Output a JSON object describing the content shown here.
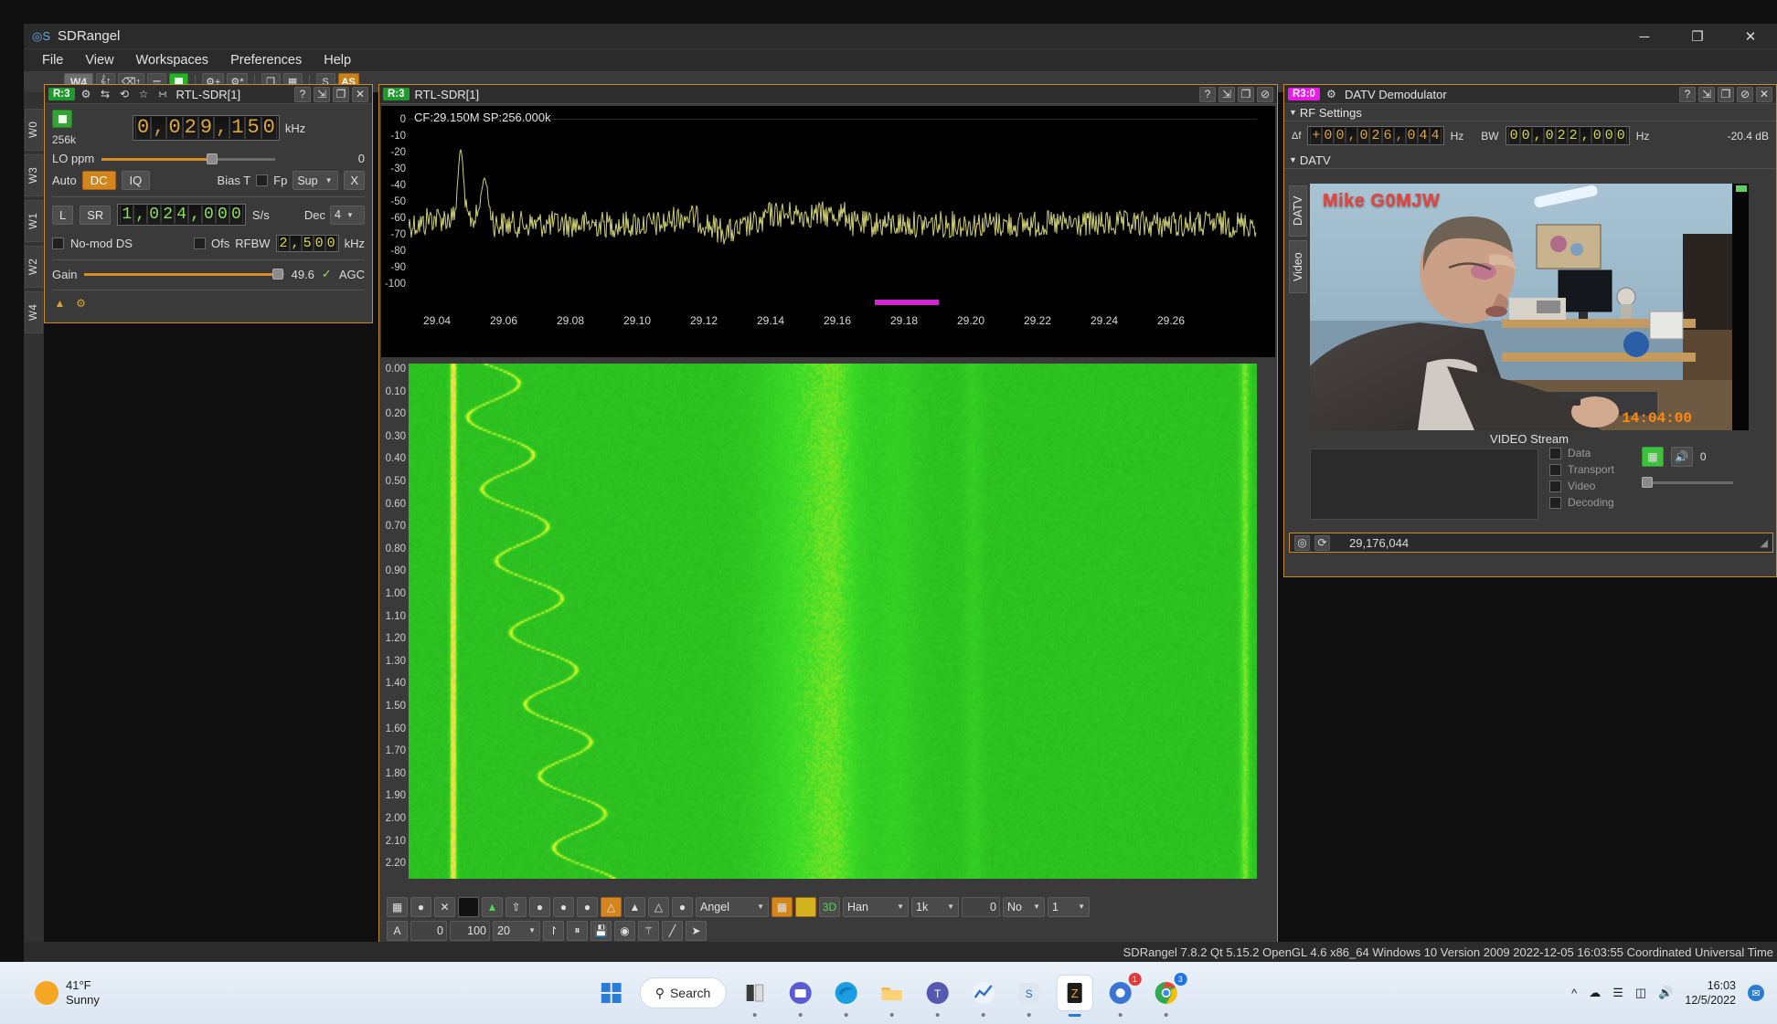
{
  "window": {
    "title": "SDRangel",
    "minimize": "─",
    "maximize": "❐",
    "close": "✕"
  },
  "menu": [
    "File",
    "View",
    "Workspaces",
    "Preferences",
    "Help"
  ],
  "main_toolbar": {
    "workspace_label": "W4",
    "buttons": [
      "rx-device-icon",
      "tx-device-icon",
      "mimo-device-icon",
      "stop-all-icon",
      "add-rx-icon",
      "add-tx-icon",
      "cascade-icon",
      "tile-icon"
    ],
    "s_label": "S",
    "as_label": "AS"
  },
  "workspace_tabs": [
    "W0",
    "W3",
    "W1",
    "W2",
    "W4"
  ],
  "device": {
    "tag": "R:3",
    "title": "RTL-SDR[1]",
    "header_icons": [
      "gear-icon",
      "swap-icon",
      "reload-icon",
      "star-icon",
      "map-icon"
    ],
    "header_right_icons": [
      "help-icon",
      "detach-icon",
      "shrink-icon",
      "hide-icon",
      "close-icon"
    ],
    "frequency": "0,029,150",
    "frequency_unit": "kHz",
    "sample_size": "256k",
    "lo_ppm_label": "LO ppm",
    "lo_ppm_value": "0",
    "auto_label": "Auto",
    "dc_label": "DC",
    "iq_label": "IQ",
    "bias_t_label": "Bias T",
    "fp_label": "Fp",
    "sup_label": "Sup",
    "x_label": "X",
    "l_label": "L",
    "sr_label": "SR",
    "sample_rate": "1,024,000",
    "sample_rate_unit": "S/s",
    "dec_label": "Dec",
    "dec_value": "4",
    "nomod_label": "No-mod DS",
    "ofs_label": "Ofs",
    "rfbw_label": "RFBW",
    "rfbw_value": "2,500",
    "rfbw_unit": "kHz",
    "gain_label": "Gain",
    "gain_value": "49.6",
    "agc_label": "AGC",
    "agc_check": "✓"
  },
  "spectrum": {
    "tag": "R:3",
    "title": "RTL-SDR[1]",
    "header_right_icons": [
      "help-icon",
      "detach-icon",
      "shrink-icon",
      "hide-icon"
    ],
    "cf_label": "CF:29.150M SP:256.000k",
    "y_ticks": [
      "0",
      "-10",
      "-20",
      "-30",
      "-40",
      "-50",
      "-60",
      "-70",
      "-80",
      "-90",
      "-100"
    ],
    "x_ticks": [
      "29.04",
      "29.06",
      "29.08",
      "29.10",
      "29.12",
      "29.14",
      "29.16",
      "29.18",
      "29.20",
      "29.22",
      "29.24",
      "29.26"
    ],
    "waterfall_ticks": [
      "0.00",
      "0.10",
      "0.20",
      "0.30",
      "0.40",
      "0.50",
      "0.60",
      "0.70",
      "0.80",
      "0.90",
      "1.00",
      "1.10",
      "1.20",
      "1.30",
      "1.40",
      "1.50",
      "1.60",
      "1.70",
      "1.80",
      "1.90",
      "2.00",
      "2.10",
      "2.20"
    ],
    "toolbar": {
      "window_fn": "Han",
      "fft_size": "1k",
      "averaging": "0",
      "avg_mode": "No",
      "ref_level": "1",
      "color_map": "Angel",
      "a_label": "A",
      "min_val": "0",
      "max_val": "100",
      "rate_val": "20"
    }
  },
  "datv": {
    "tag": "R3:0",
    "title": "DATV Demodulator",
    "header_right_icons": [
      "help-icon",
      "detach-icon",
      "shrink-icon",
      "hide-icon",
      "close-icon"
    ],
    "rf_settings_label": "RF Settings",
    "datv_label": "DATV",
    "df_label": "Δf",
    "df_value": "+00,026,044",
    "df_unit": "Hz",
    "bw_label": "BW",
    "bw_value": "00,022,000",
    "bw_unit": "Hz",
    "level_db": "-20.4 dB",
    "tabs": [
      "DATV",
      "Video"
    ],
    "video_caption": "VIDEO Stream",
    "video_callsign": "Mike G0MJW",
    "video_timecode": "14:04:00",
    "status_items": [
      "Data",
      "Transport",
      "Video",
      "Decoding"
    ],
    "volume_value": "0",
    "stream_icons": [
      "video-stream-icon",
      "audio-volume-icon"
    ],
    "footer_icons": [
      "target-icon",
      "reset-icon"
    ],
    "footer_frequency": "29,176,044"
  },
  "statusbar": {
    "text": "SDRangel 7.8.2 Qt 5.15.2 OpenGL 4.6 x86_64 Windows 10 Version 2009  2022-12-05 16:03:55 Coordinated Universal Time"
  },
  "taskbar": {
    "temperature": "41°F",
    "condition": "Sunny",
    "search_placeholder": "Search",
    "time": "16:03",
    "date": "12/5/2022",
    "apps": [
      "start-icon",
      "search-icon",
      "widgets-icon",
      "mail-icon",
      "edge-icon",
      "explorer-icon",
      "teams-icon",
      "chart-icon",
      "sdrangel-icon",
      "app-icon",
      "browser-icon",
      "chrome-icon"
    ],
    "tray_icons": [
      "chevron-up-icon",
      "cloud-icon",
      "network-icon",
      "battery-icon",
      "volume-icon",
      "notification-icon"
    ]
  },
  "colors": {
    "accent_orange": "#c88a2a",
    "green_tag": "#1f9b2e",
    "magenta_tag": "#e919e9",
    "digit_amber": "#e0a83c",
    "digit_green": "#8fe05a"
  }
}
